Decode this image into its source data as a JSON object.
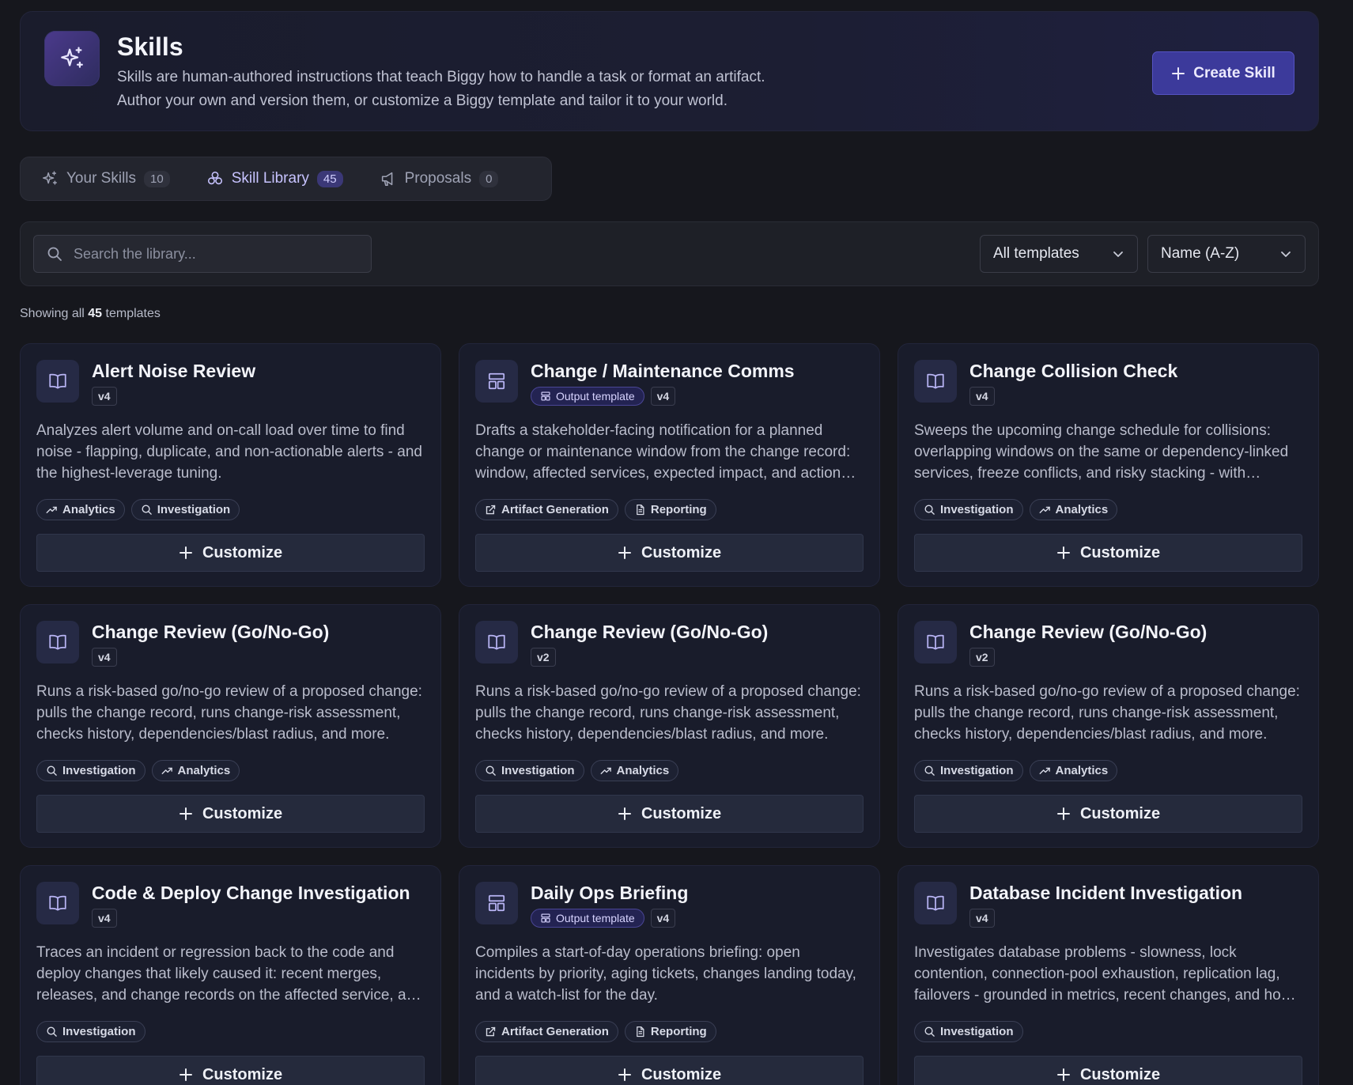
{
  "header": {
    "title": "Skills",
    "desc_line1": "Skills are human-authored instructions that teach Biggy how to handle a task or format an artifact.",
    "desc_line2": "Author your own and version them, or customize a Biggy template and tailor it to your world.",
    "create_label": "Create Skill",
    "icon": "sparkles-icon"
  },
  "tabs": [
    {
      "label": "Your Skills",
      "count": "10",
      "icon": "sparkles-icon"
    },
    {
      "label": "Skill Library",
      "count": "45",
      "icon": "library-icon"
    },
    {
      "label": "Proposals",
      "count": "0",
      "icon": "megaphone-icon"
    }
  ],
  "toolbar": {
    "search_placeholder": "Search the library...",
    "filter_value": "All templates",
    "sort_value": "Name (A-Z)"
  },
  "showing": {
    "prefix": "Showing all",
    "count": "45",
    "suffix": "templates"
  },
  "customize_label": "Customize",
  "output_template_label": "Output template",
  "cards": [
    {
      "title": "Alert Noise Review",
      "version": "v4",
      "output_template": false,
      "desc": "Analyzes alert volume and on-call load over time to find noise - flapping, duplicate, and non-actionable alerts - and the highest-leverage tuning.",
      "tags": [
        "Analytics",
        "Investigation"
      ]
    },
    {
      "title": "Change / Maintenance Comms",
      "version": "v4",
      "output_template": true,
      "desc": "Drafts a stakeholder-facing notification for a planned change or maintenance window from the change record: window, affected services, expected impact, and action items.",
      "tags": [
        "Artifact Generation",
        "Reporting"
      ]
    },
    {
      "title": "Change Collision Check",
      "version": "v4",
      "output_template": false,
      "desc": "Sweeps the upcoming change schedule for collisions: overlapping windows on the same or dependency-linked services, freeze conflicts, and risky stacking - with recommendations.",
      "tags": [
        "Investigation",
        "Analytics"
      ]
    },
    {
      "title": "Change Review (Go/No-Go)",
      "version": "v4",
      "output_template": false,
      "desc": "Runs a risk-based go/no-go review of a proposed change: pulls the change record, runs change-risk assessment, checks history, dependencies/blast radius, and more.",
      "tags": [
        "Investigation",
        "Analytics"
      ]
    },
    {
      "title": "Change Review (Go/No-Go)",
      "version": "v2",
      "output_template": false,
      "desc": "Runs a risk-based go/no-go review of a proposed change: pulls the change record, runs change-risk assessment, checks history, dependencies/blast radius, and more.",
      "tags": [
        "Investigation",
        "Analytics"
      ]
    },
    {
      "title": "Change Review (Go/No-Go)",
      "version": "v2",
      "output_template": false,
      "desc": "Runs a risk-based go/no-go review of a proposed change: pulls the change record, runs change-risk assessment, checks history, dependencies/blast radius, and more.",
      "tags": [
        "Investigation",
        "Analytics"
      ]
    },
    {
      "title": "Code & Deploy Change Investigation",
      "version": "v4",
      "output_template": false,
      "desc": "Traces an incident or regression back to the code and deploy changes that likely caused it: recent merges, releases, and change records on the affected service, and more.",
      "tags": [
        "Investigation"
      ]
    },
    {
      "title": "Daily Ops Briefing",
      "version": "v4",
      "output_template": true,
      "desc": "Compiles a start-of-day operations briefing: open incidents by priority, aging tickets, changes landing today, and a watch-list for the day.",
      "tags": [
        "Artifact Generation",
        "Reporting"
      ]
    },
    {
      "title": "Database Incident Investigation",
      "version": "v4",
      "output_template": false,
      "desc": "Investigates database problems - slowness, lock contention, connection-pool exhaustion, replication lag, failovers - grounded in metrics, recent changes, and how they interact.",
      "tags": [
        "Investigation"
      ]
    }
  ],
  "colors": {
    "accent": "#3c3a9b",
    "background": "#16171d",
    "card": "#191c2b"
  }
}
